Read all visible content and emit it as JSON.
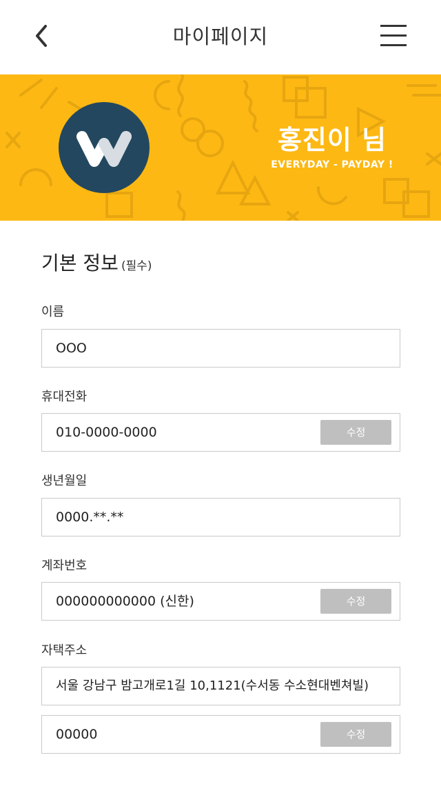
{
  "header": {
    "title": "마이페이지",
    "back_icon": "chevron-left-icon",
    "menu_icon": "hamburger-menu-icon"
  },
  "banner": {
    "background_color": "#fdb813",
    "avatar_color": "#23475f",
    "greeting": "홍진이 님",
    "slogan": "EVERYDAY - PAYDAY !"
  },
  "section": {
    "title": "기본 정보",
    "required_note": "(필수)"
  },
  "fields": {
    "name": {
      "label": "이름",
      "value": "OOO"
    },
    "phone": {
      "label": "휴대전화",
      "value": "010-0000-0000",
      "button": "수정"
    },
    "birth": {
      "label": "생년월일",
      "value": "0000.**.**"
    },
    "account": {
      "label": "계좌번호",
      "value": "000000000000 (신한)",
      "button": "수정"
    },
    "address": {
      "label": "자택주소",
      "value": "서울 강남구 밤고개로1길 10,1121(수서동 수소현대벤쳐빌)"
    },
    "zipcode": {
      "value": "00000",
      "button": "수정"
    }
  }
}
